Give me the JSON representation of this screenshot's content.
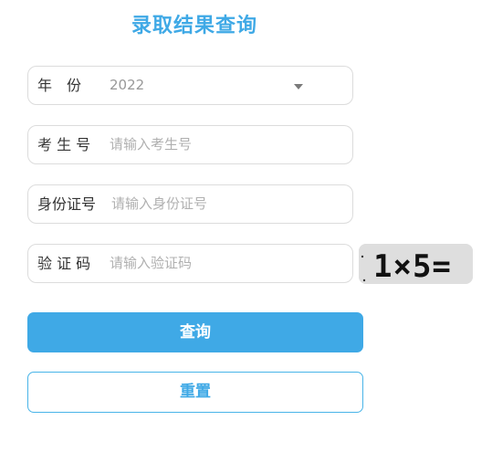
{
  "title": "录取结果查询",
  "form": {
    "year": {
      "label": "年　份",
      "value": "2022"
    },
    "exam_no": {
      "label": "考 生 号",
      "placeholder": "请输入考生号"
    },
    "id_no": {
      "label": "身份证号",
      "placeholder": "请输入身份证号"
    },
    "captcha": {
      "label": "验 证 码",
      "placeholder": "请输入验证码"
    }
  },
  "captcha_image": {
    "text": "1×5="
  },
  "buttons": {
    "query": "查询",
    "reset": "重置"
  },
  "colors": {
    "accent": "#3fa9e6",
    "border": "#dcdcdc"
  }
}
